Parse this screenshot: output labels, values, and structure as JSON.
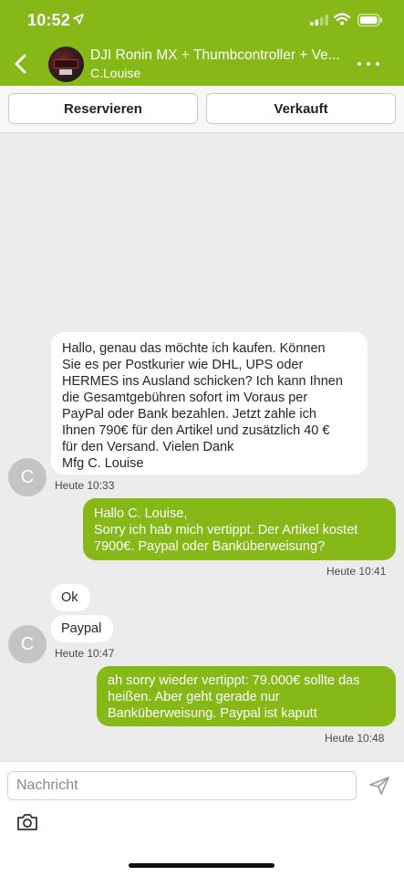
{
  "status_bar": {
    "time": "10:52"
  },
  "header": {
    "title": "DJI Ronin MX + Thumbcontroller + Ve...",
    "subtitle": "C.Louise"
  },
  "actions": {
    "reserve_label": "Reservieren",
    "sold_label": "Verkauft"
  },
  "messages": [
    {
      "direction": "in",
      "text": "Hallo, genau das möchte ich kaufen. Können\nSie es per Postkurier wie DHL, UPS oder\nHERMES ins Ausland schicken? Ich kann Ihnen\ndie Gesamtgebühren sofort im Voraus per\nPayPal oder Bank bezahlen. Jetzt zahle ich\nIhnen 790€ für den Artikel und zusätzlich 40 €\nfür den Versand. Vielen Dank\n Mfg C. Louise",
      "time": "Heute 10:33"
    },
    {
      "direction": "out",
      "text": "Hallo C. Louise,\nSorry ich hab mich vertippt. Der Artikel kostet\n7900€. Paypal oder Banküberweisung?",
      "time": "Heute 10:41"
    },
    {
      "direction": "in",
      "text": "Ok"
    },
    {
      "direction": "in",
      "text": "Paypal",
      "time": "Heute 10:47"
    },
    {
      "direction": "out",
      "text": "ah sorry wieder vertippt: 79.000€ sollte das\nheißen. Aber geht gerade nur\nBanküberweisung. Paypal ist kaputt",
      "time": "Heute 10:48"
    }
  ],
  "avatar_letter": "C",
  "composer": {
    "placeholder": "Nachricht"
  },
  "colors": {
    "brand_green": "#86b817",
    "chat_background": "#ececec"
  },
  "icons": [
    "location-arrow-icon",
    "signal-icon",
    "wifi-icon",
    "battery-icon",
    "back-chevron-icon",
    "more-dots-icon",
    "send-icon",
    "camera-icon"
  ]
}
